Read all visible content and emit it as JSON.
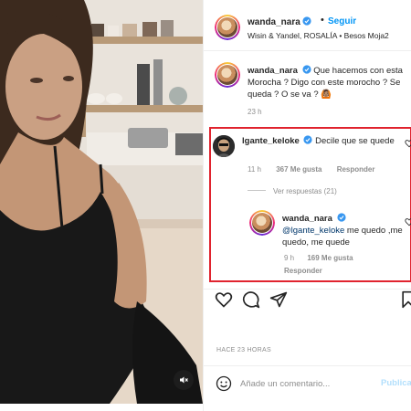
{
  "post": {
    "author": "wanda_nara",
    "follow_dot": "•",
    "follow_label": "Seguir",
    "audio_line": "Wisin & Yandel, ROSALÍA • Besos Moja2"
  },
  "caption": {
    "username": "wanda_nara",
    "text": "Que hacemos con esta Morocha ? Digo con este morocho ? Se queda ? O se va ? 🙆🏽",
    "time": "23 h"
  },
  "comment": {
    "username": "lgante_keloke",
    "text": "Decile que se quede",
    "time": "11 h",
    "likes": "367 Me gusta",
    "reply_label": "Responder",
    "view_replies": "Ver respuestas (21)"
  },
  "reply": {
    "username": "wanda_nara",
    "mention": "@lgante_keloke",
    "text": " me quedo ,me quedo, me quede",
    "time": "9 h",
    "likes": "169 Me gusta",
    "reply_label": "Responder"
  },
  "actions": {
    "like": "heart-icon",
    "comment": "comment-icon",
    "share": "share-icon",
    "save": "bookmark-icon"
  },
  "date_label": "HACE 23 HORAS",
  "comment_bar": {
    "placeholder": "Añade un comentario...",
    "publish_label": "Publicar"
  },
  "colors": {
    "accent": "#0095f6",
    "highlight_border": "#e0232e",
    "verified": "#3897f0"
  }
}
